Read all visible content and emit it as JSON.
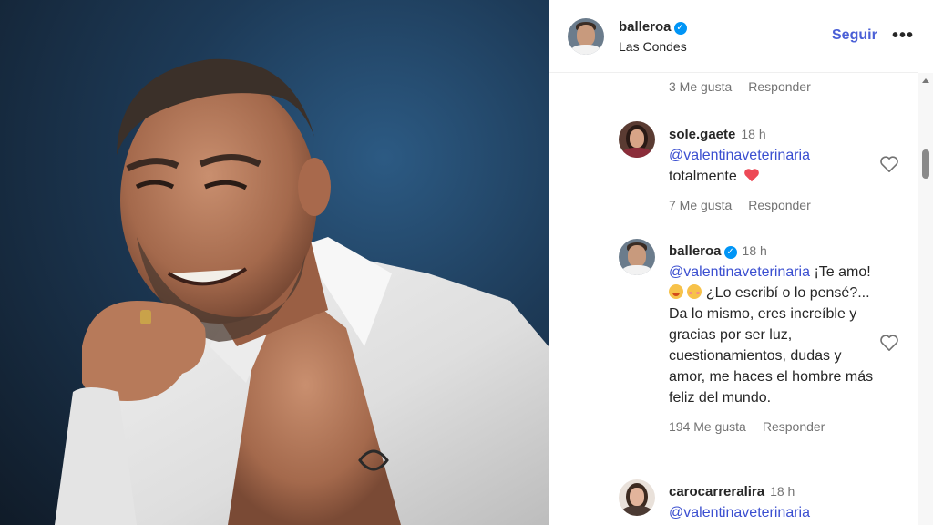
{
  "post": {
    "username": "balleroa",
    "location": "Las Condes",
    "follow_label": "Seguir",
    "more_label": "•••"
  },
  "prev_comment_meta": {
    "likes": "3 Me gusta",
    "reply": "Responder"
  },
  "comments": [
    {
      "username": "sole.gaete",
      "time": "18 h",
      "mention": "@valentinaveterinaria",
      "text": "totalmente",
      "emoji": "heart",
      "likes": "7 Me gusta",
      "reply": "Responder"
    },
    {
      "username": "balleroa",
      "time": "18 h",
      "verified": true,
      "mention": "@valentinaveterinaria",
      "text_part1": " ¡Te amo! ",
      "text_part2": " ¿Lo escribí o lo pensé?... Da lo mismo, eres increíble y gracias por ser luz, cuestionamientos, dudas y amor, me haces el hombre más feliz del mundo.",
      "likes": "194 Me gusta",
      "reply": "Responder"
    },
    {
      "username": "carocarreralira",
      "time": "18 h",
      "mention": "@valentinaveterinaria"
    }
  ],
  "colors": {
    "accent": "#4a5fd6",
    "verified": "#0095f6",
    "heart": "#ed4956",
    "muted": "#737373"
  },
  "icons": {
    "verified": "verified-badge-icon",
    "like": "heart-outline-icon",
    "heart_emoji": "red-heart-emoji"
  }
}
